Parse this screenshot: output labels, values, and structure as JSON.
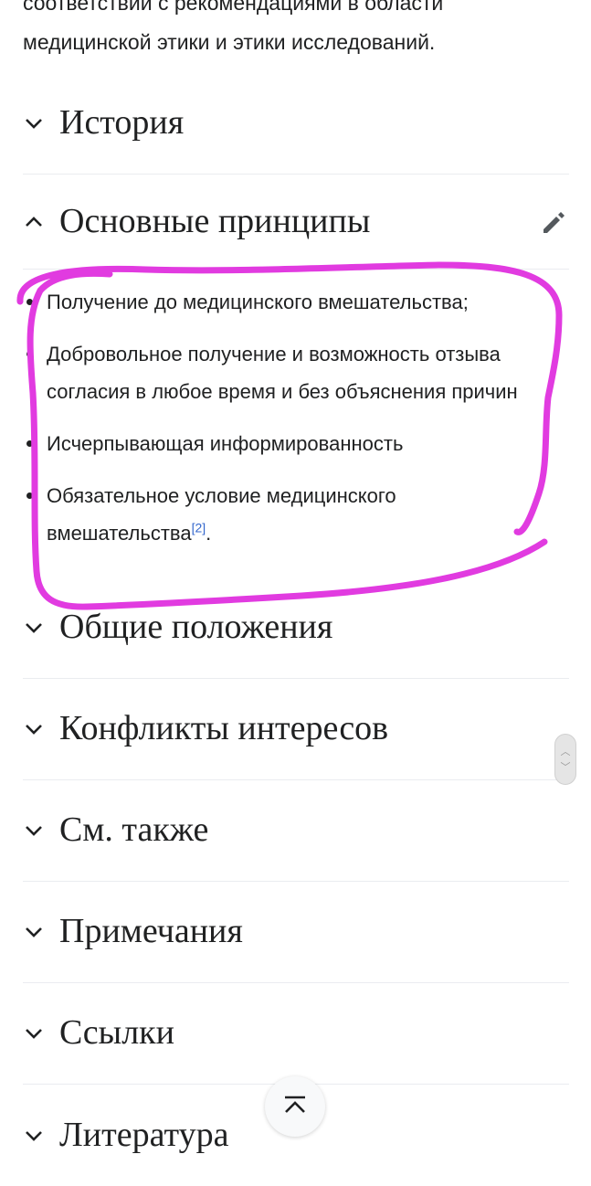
{
  "intro": {
    "line1": "соответствии с рекомендациями в области",
    "line2": "медицинской этики и этики исследований."
  },
  "sections": {
    "history": {
      "title": "История",
      "expanded": false
    },
    "principles": {
      "title": "Основные принципы",
      "expanded": true
    },
    "general": {
      "title": "Общие положения",
      "expanded": false
    },
    "conflicts": {
      "title": "Конфликты интересов",
      "expanded": false
    },
    "see_also": {
      "title": "См. также",
      "expanded": false
    },
    "notes": {
      "title": "Примечания",
      "expanded": false
    },
    "links": {
      "title": "Ссылки",
      "expanded": false
    },
    "literature": {
      "title": "Литература",
      "expanded": false
    }
  },
  "principles_list": {
    "item1": "Получение до медицинского вмешательства;",
    "item2": "Добровольное получение и возможность отзыва согласия в любое время и без объяснения причин",
    "item3": "Исчерпывающая информированность",
    "item4": "Обязательное условие медицинского вмешательства",
    "item4_ref": "[2]",
    "item4_end": "."
  },
  "icons": {
    "chevron_down": "chevron-down-icon",
    "chevron_up": "chevron-up-icon",
    "edit": "pencil-icon",
    "back_to_top": "back-to-top-icon"
  },
  "colors": {
    "text": "#202122",
    "link": "#3366cc",
    "divider": "#eaecf0",
    "annotation": "#e13be0"
  }
}
